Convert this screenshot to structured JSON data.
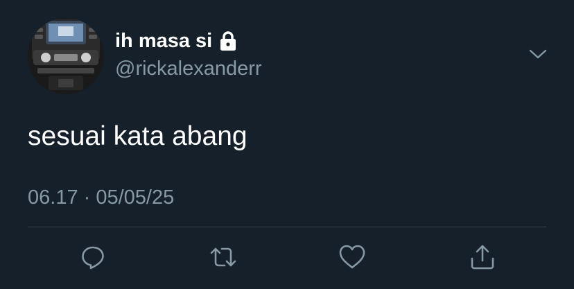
{
  "tweet": {
    "display_name": "ih masa si",
    "handle": "@rickalexanderr",
    "text": "sesuai kata abang",
    "timestamp": "06.17 · 05/05/25"
  },
  "icons": {
    "lock": "lock-icon",
    "menu": "chevron-down-icon",
    "reply": "reply-icon",
    "retweet": "retweet-icon",
    "like": "heart-icon",
    "share": "share-icon"
  },
  "colors": {
    "background": "#15202b",
    "primary_text": "#ffffff",
    "secondary_text": "#8899a6",
    "divider": "#38444d"
  }
}
